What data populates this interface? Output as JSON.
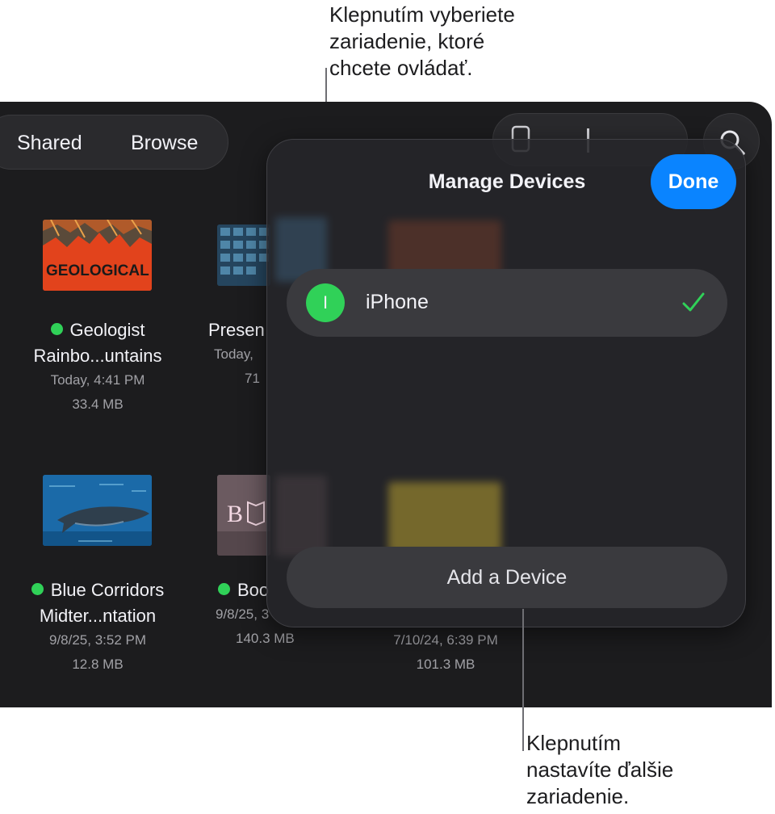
{
  "callouts": {
    "top": [
      "Klepnutím vyberiete",
      "zariadenie, ktoré",
      "chcete ovládať."
    ],
    "bottom": [
      "Klepnutím",
      "nastavíte ďalšie",
      "zariadenie."
    ]
  },
  "toolbar": {
    "segments": [
      "Shared",
      "Browse"
    ],
    "search_icon": "magnifying-glass-icon"
  },
  "files": [
    {
      "name": "Geologist",
      "name2": "Rainbo...untains",
      "date": "Today, 4:41 PM",
      "size": "33.4 MB",
      "synced": true,
      "thumb_text": "GEOLOGICAL OVERVIEW"
    },
    {
      "name": "Presen",
      "date": "Today,",
      "size": "71",
      "synced": false
    },
    {
      "name": "Blue Corridors",
      "name2": "Midter...ntation",
      "date": "9/8/25, 3:52 PM",
      "size": "12.8 MB",
      "synced": true
    },
    {
      "name": "Boo",
      "date": "9/8/25, 3",
      "size": "140.3 MB",
      "synced": true,
      "thumb_text": "BOOK"
    },
    {
      "date": "7/10/24, 6:39 PM",
      "size": "101.3 MB"
    }
  ],
  "manage_devices": {
    "title": "Manage Devices",
    "done_label": "Done",
    "devices": [
      {
        "initial": "I",
        "name": "iPhone",
        "selected": true
      }
    ],
    "add_label": "Add a Device"
  },
  "colors": {
    "accent": "#0a84ff",
    "success": "#30d158",
    "background": "#1c1c1e",
    "panel": "#26262a"
  }
}
